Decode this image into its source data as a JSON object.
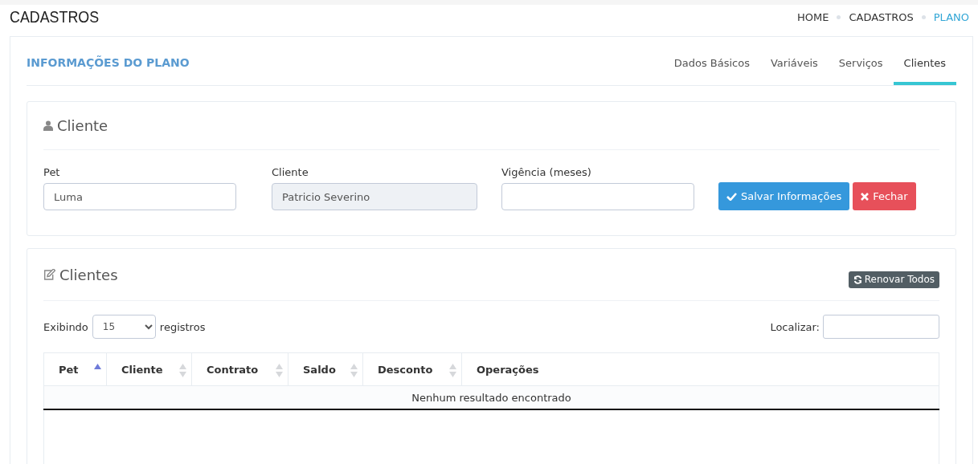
{
  "page_title": "CADASTROS",
  "breadcrumb": [
    {
      "label": "HOME",
      "selected": false
    },
    {
      "label": "CADASTROS",
      "selected": false
    },
    {
      "label": "PLANO",
      "selected": true
    }
  ],
  "panel": {
    "title": "INFORMAÇÕES DO PLANO",
    "tabs": [
      {
        "label": "Dados Básicos",
        "selected": false
      },
      {
        "label": "Variáveis",
        "selected": false
      },
      {
        "label": "Serviços",
        "selected": false
      },
      {
        "label": "Clientes",
        "selected": true
      }
    ]
  },
  "client_form": {
    "title": "Cliente",
    "fields": [
      {
        "label": "Pet",
        "value": "Luma",
        "disabled": false
      },
      {
        "label": "Cliente",
        "value": "Patricio Severino",
        "disabled": true
      },
      {
        "label": "Vigência (meses)",
        "disabled": false
      }
    ],
    "buttons": [
      {
        "label": "Salvar Informações",
        "kind": "save"
      },
      {
        "label": "Fechar",
        "kind": "close"
      }
    ]
  },
  "clients_table": {
    "title": "Clientes",
    "renew_button": "Renovar Todos",
    "length_prefix": "Exibindo",
    "length_value": "15",
    "length_suffix": "registros",
    "search_label": "Localizar:",
    "columns": [
      {
        "label": "Pet",
        "sortable": true,
        "sorted": true
      },
      {
        "label": "Cliente",
        "sortable": true,
        "sorted": false
      },
      {
        "label": "Contrato",
        "sortable": true,
        "sorted": false
      },
      {
        "label": "Saldo",
        "sortable": true,
        "sorted": false
      },
      {
        "label": "Desconto",
        "sortable": true,
        "sorted": false
      },
      {
        "label": "Operações",
        "sortable": false
      }
    ],
    "empty_message": "Nenhum resultado encontrado"
  }
}
